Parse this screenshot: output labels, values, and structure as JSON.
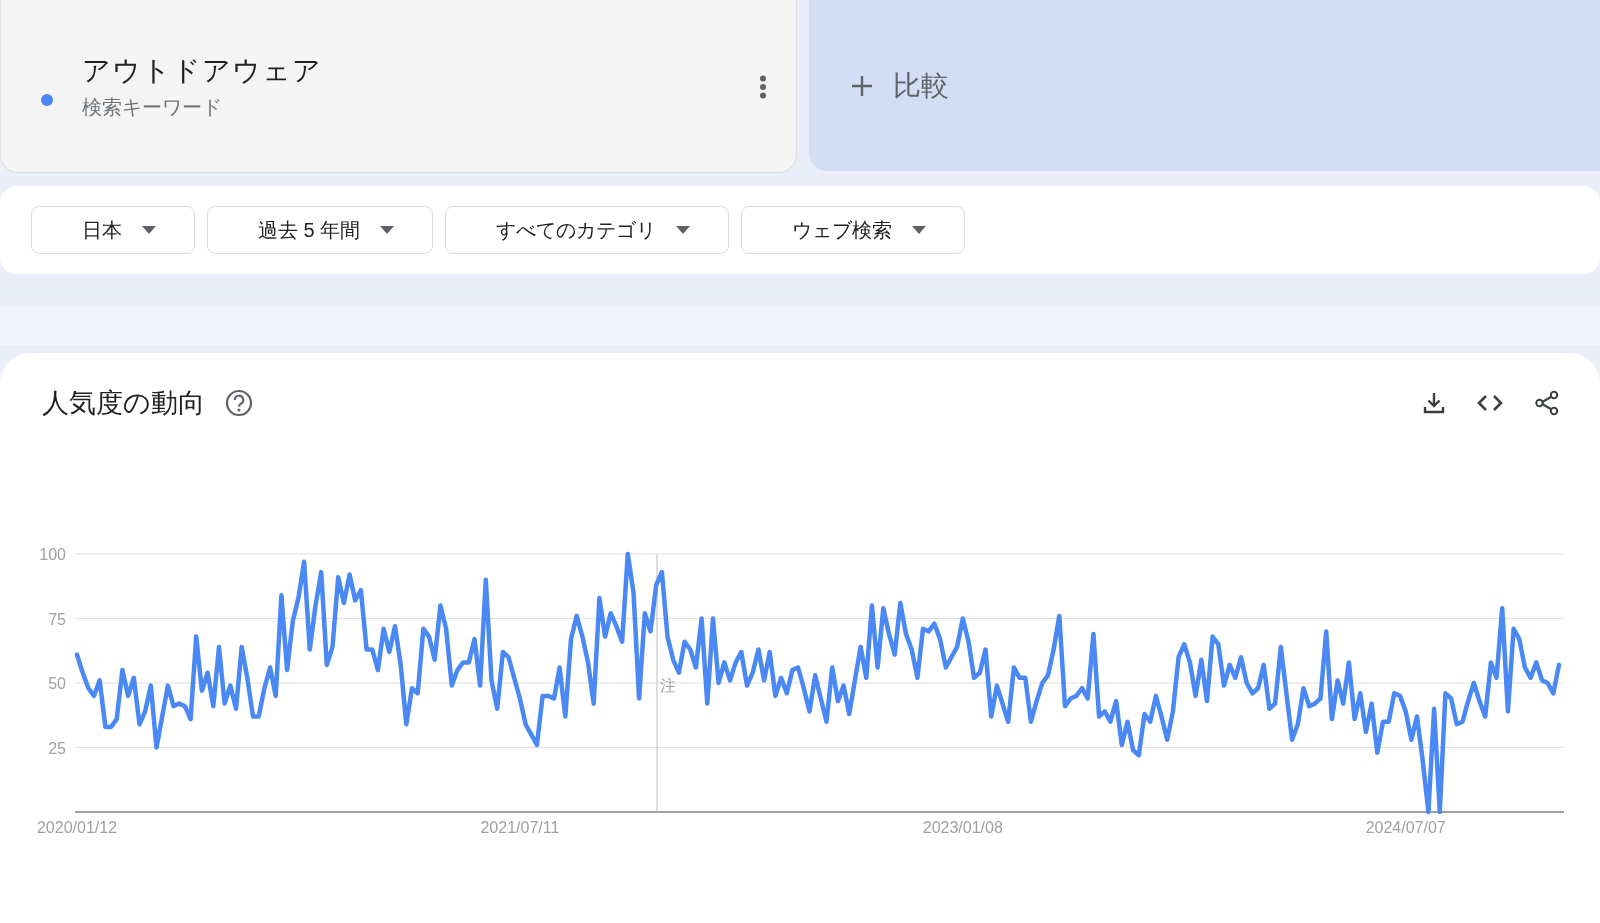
{
  "search_term": {
    "label": "アウトドアウェア",
    "sublabel": "検索キーワード"
  },
  "compare": {
    "label": "比較"
  },
  "filters": [
    {
      "label": "日本"
    },
    {
      "label": "過去 5 年間"
    },
    {
      "label": "すべてのカテゴリ"
    },
    {
      "label": "ウェブ検索"
    }
  ],
  "trend": {
    "title": "人気度の動向",
    "chart_data": {
      "type": "line",
      "categories": [
        "2020/01/12",
        null,
        null,
        null,
        null,
        null,
        null,
        null,
        null,
        null,
        null,
        null,
        null,
        null,
        null,
        null,
        null,
        null,
        null,
        null,
        null,
        null,
        null,
        null,
        null,
        null,
        null,
        null,
        null,
        null,
        null,
        null,
        null,
        null,
        null,
        null,
        null,
        null,
        null,
        null,
        null,
        null,
        null,
        null,
        null,
        null,
        null,
        null,
        null,
        null,
        null,
        null,
        null,
        null,
        null,
        null,
        null,
        null,
        null,
        null,
        null,
        null,
        null,
        null,
        null,
        null,
        null,
        null,
        null,
        null,
        null,
        null,
        null,
        null,
        null,
        null,
        null,
        null,
        "2021/07/11",
        null,
        null,
        null,
        null,
        null,
        null,
        null,
        null,
        null,
        null,
        null,
        null,
        null,
        null,
        null,
        null,
        null,
        null,
        null,
        null,
        null,
        null,
        null,
        null,
        null,
        null,
        null,
        null,
        null,
        null,
        null,
        null,
        null,
        null,
        null,
        null,
        null,
        null,
        null,
        null,
        null,
        null,
        null,
        null,
        null,
        null,
        null,
        null,
        null,
        null,
        null,
        null,
        null,
        null,
        null,
        null,
        null,
        null,
        null,
        null,
        null,
        null,
        null,
        null,
        null,
        null,
        null,
        null,
        null,
        null,
        null,
        null,
        null,
        null,
        null,
        null,
        null,
        "2023/01/08",
        null,
        null,
        null,
        null,
        null,
        null,
        null,
        null,
        null,
        null,
        null,
        null,
        null,
        null,
        null,
        null,
        null,
        null,
        null,
        null,
        null,
        null,
        null,
        null,
        null,
        null,
        null,
        null,
        null,
        null,
        null,
        null,
        null,
        null,
        null,
        null,
        null,
        null,
        null,
        null,
        null,
        null,
        null,
        null,
        null,
        null,
        null,
        null,
        null,
        null,
        null,
        null,
        null,
        null,
        null,
        null,
        null,
        null,
        null,
        null,
        null,
        null,
        null,
        null,
        null,
        null,
        null,
        null,
        null,
        null,
        null,
        null,
        null,
        null,
        null,
        null,
        null,
        "2024/07/07",
        null,
        null,
        null,
        null,
        null,
        null,
        null,
        null,
        null,
        null,
        null,
        null,
        null,
        null,
        null,
        null,
        null,
        null,
        null,
        null,
        null,
        null,
        null,
        null,
        null,
        null,
        null
      ],
      "series": [
        {
          "color": "#4a89f3",
          "values": [
            61,
            54,
            48,
            45,
            51,
            33,
            33,
            36,
            55,
            45,
            52,
            34,
            39,
            49,
            25,
            37,
            49,
            41,
            42,
            41,
            36,
            68,
            47,
            54,
            41,
            64,
            42,
            49,
            40,
            64,
            52,
            37,
            37,
            48,
            56,
            45,
            84,
            55,
            74,
            83,
            97,
            63,
            80,
            93,
            57,
            64,
            91,
            81,
            92,
            82,
            86,
            63,
            63,
            55,
            71,
            62,
            72,
            57,
            34,
            48,
            46,
            71,
            68,
            59,
            80,
            71,
            49,
            55,
            58,
            58,
            67,
            49,
            90,
            51,
            40,
            62,
            60,
            52,
            44,
            34,
            30,
            26,
            45,
            45,
            44,
            56,
            37,
            67,
            76,
            68,
            58,
            42,
            83,
            68,
            77,
            72,
            66,
            100,
            85,
            44,
            77,
            70,
            88,
            93,
            68,
            59,
            54,
            66,
            63,
            56,
            75,
            42,
            75,
            50,
            58,
            51,
            58,
            62,
            49,
            54,
            63,
            51,
            62,
            45,
            52,
            46,
            55,
            56,
            48,
            39,
            53,
            44,
            35,
            56,
            43,
            49,
            38,
            51,
            64,
            52,
            80,
            56,
            79,
            69,
            61,
            81,
            69,
            63,
            52,
            71,
            70,
            73,
            67,
            56,
            60,
            64,
            75,
            66,
            52,
            54,
            63,
            37,
            49,
            42,
            35,
            56,
            52,
            52,
            35,
            43,
            50,
            53,
            63,
            76,
            41,
            44,
            45,
            48,
            44,
            69,
            37,
            39,
            35,
            43,
            26,
            35,
            24,
            22,
            38,
            35,
            45,
            37,
            28,
            39,
            60,
            65,
            58,
            45,
            59,
            43,
            68,
            65,
            49,
            57,
            52,
            60,
            50,
            46,
            48,
            57,
            40,
            42,
            64,
            46,
            28,
            34,
            48,
            41,
            42,
            44,
            70,
            36,
            51,
            42,
            58,
            36,
            46,
            31,
            42,
            23,
            35,
            35,
            46,
            45,
            39,
            28,
            37,
            20,
            0,
            40,
            0,
            46,
            44,
            34,
            35,
            43,
            50,
            43,
            37,
            58,
            52,
            79,
            39,
            71,
            67,
            56,
            52,
            58,
            51,
            50,
            46,
            57
          ]
        }
      ],
      "ylim": [
        0,
        100
      ],
      "grid": true,
      "yticks": [
        25,
        50,
        75,
        100
      ],
      "annotations": [
        "注"
      ]
    }
  }
}
